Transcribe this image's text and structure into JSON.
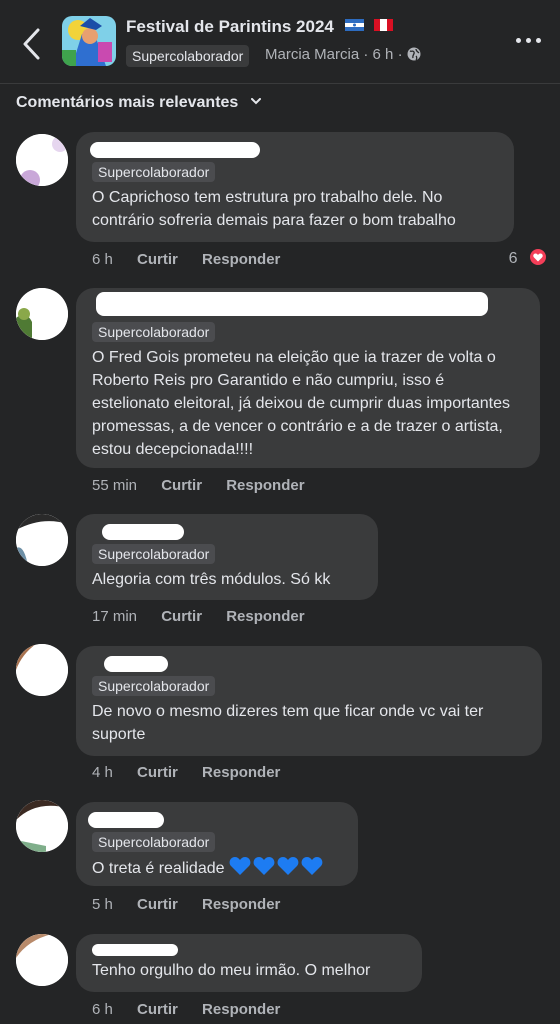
{
  "header": {
    "title": "Festival de Parintins 2024",
    "badge": "Supercolaborador",
    "author": "Marcia Marcia",
    "time": "6 h",
    "separator": "·"
  },
  "sort": {
    "label": "Comentários mais relevantes"
  },
  "comments": [
    {
      "badge": "Supercolaborador",
      "text": "O Caprichoso tem estrutura pro trabalho dele. No contrário sofreria demais para fazer o bom trabalho",
      "time": "6 h",
      "like": "Curtir",
      "reply": "Responder",
      "reaction_count": "6"
    },
    {
      "badge": "Supercolaborador",
      "text": "O Fred Gois prometeu na eleição que ia trazer de volta o Roberto Reis pro Garantido e não cumpriu, isso é estelionato eleitoral, já deixou de cumprir duas importantes promessas, a de vencer o contrário e a de trazer o artista, estou decepcionada!!!!",
      "time": "55 min",
      "like": "Curtir",
      "reply": "Responder"
    },
    {
      "badge": "Supercolaborador",
      "text": "Alegoria com três módulos.  Só kk",
      "time": "17 min",
      "like": "Curtir",
      "reply": "Responder"
    },
    {
      "badge": "Supercolaborador",
      "text": "De novo o mesmo dizeres tem que ficar onde vc vai ter suporte",
      "time": "4 h",
      "like": "Curtir",
      "reply": "Responder"
    },
    {
      "badge": "Supercolaborador",
      "text": "O treta é realidade",
      "time": "5 h",
      "like": "Curtir",
      "reply": "Responder"
    },
    {
      "text": "Tenho  orgulho do meu irmão. O melhor",
      "time": "6 h",
      "like": "Curtir",
      "reply": "Responder"
    }
  ],
  "colors": {
    "background": "#242526",
    "bubble": "#3a3b3c",
    "muted_text": "#b0b3b8",
    "heart": "#f33e58",
    "blue_heart": "#1d7cf2"
  },
  "icons": [
    "back-arrow-icon",
    "globe-icon",
    "more-options-icon",
    "chevron-down-icon",
    "heart-reaction-icon",
    "blue-heart-emoji"
  ]
}
